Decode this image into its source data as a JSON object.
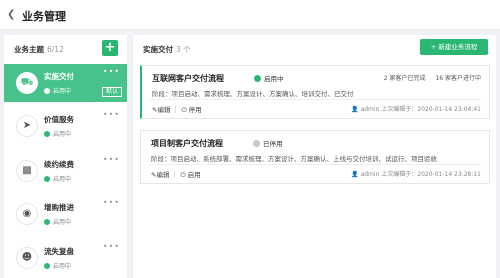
{
  "header": {
    "title": "业务管理",
    "back_icon": "chevron-left-icon"
  },
  "topics_panel": {
    "title": "业务主题",
    "count": "6/12",
    "add_icon": "plus-icon",
    "items": [
      {
        "name": "实施交付",
        "status": "启用中",
        "badge": "默认",
        "icon": "delivery-truck-icon",
        "more": "•••"
      },
      {
        "name": "价值服务",
        "status": "启用中",
        "icon": "rocket-icon",
        "more": "•••"
      },
      {
        "name": "续约续费",
        "status": "启用中",
        "icon": "ticket-icon",
        "more": "•••"
      },
      {
        "name": "增购推进",
        "status": "启用中",
        "icon": "toggle-icon",
        "more": "•••"
      },
      {
        "name": "流失复盘",
        "status": "启用中",
        "icon": "people-icon",
        "more": "•••"
      }
    ]
  },
  "flows_panel": {
    "title": "实施交付",
    "count": "3 个",
    "new_button": "+ 新建业务流程",
    "cards": [
      {
        "title": "互联网客户交付流程",
        "status": "启用中",
        "status_color": "#2bb673",
        "stat_done": "2 家客户已完成",
        "stat_progress": "16 家客户进行中",
        "stages": "阶段：项目启动、需求梳理、方案设计、方案确认、培训交付、已交付",
        "edit": "编辑",
        "toggle": "停用",
        "meta": "admin 上次编辑于：2020-01-14 23:04:41"
      },
      {
        "title": "项目制客户交付流程",
        "status": "已停用",
        "status_color": "#c8c8c8",
        "stages": "阶段：项目启动、系统部署、需求梳理、方案设计、方案确认、上线与交付培训、试运行、项目验收",
        "edit": "编辑",
        "toggle": "启用",
        "meta": "admin 上次编辑于：2020-01-14 23:28:11"
      }
    ]
  }
}
